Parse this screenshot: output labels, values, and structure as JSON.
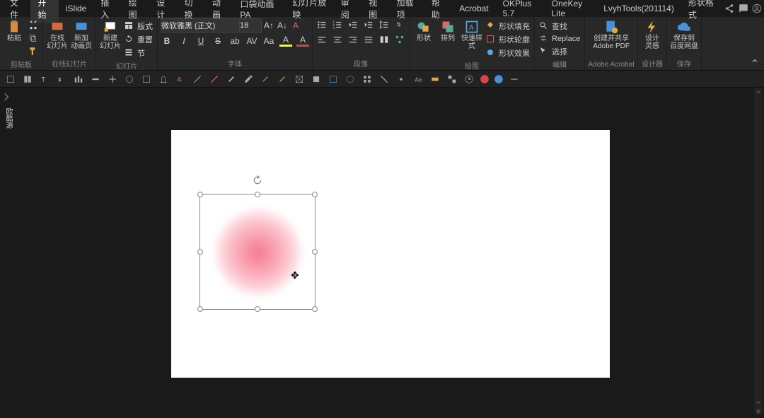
{
  "tabs": [
    "文件",
    "开始",
    "iSlide",
    "插入",
    "绘图",
    "设计",
    "切换",
    "动画",
    "口袋动画 PA",
    "幻灯片放映",
    "审阅",
    "视图",
    "加载项",
    "帮助",
    "Acrobat",
    "OKPlus 5.7",
    "OneKey Lite",
    "LvyhTools(201114)",
    "形状格式"
  ],
  "activeTab": 1,
  "ribbon": {
    "clipboard": {
      "paste": "粘贴",
      "label": "剪贴板"
    },
    "online": {
      "btn1": "在线\n幻灯片",
      "btn2": "新加\n动画页",
      "label": "在线幻灯片"
    },
    "slides": {
      "btn": "新建\n幻灯片",
      "opt1": "版式",
      "opt2": "重置",
      "opt3": "节",
      "label": "幻灯片"
    },
    "font": {
      "name": "微软雅黑 (正文)",
      "size": "18",
      "label": "字体"
    },
    "para": {
      "label": "段落"
    },
    "draw": {
      "b1": "形状",
      "b2": "排列",
      "b3": "快速样式",
      "o1": "形状填充",
      "o2": "形状轮廓",
      "o3": "形状效果",
      "label": "绘图"
    },
    "edit": {
      "o1": "查找",
      "o2": "Replace",
      "o3": "选择",
      "label": "编辑"
    },
    "acrobat": {
      "btn": "创建并共享\nAdobe PDF",
      "label": "Adobe Acrobat"
    },
    "designer": {
      "btn": "设计\n灵感",
      "label": "设计器"
    },
    "save": {
      "btn": "保存到\n百度网盘",
      "label": "保存"
    }
  },
  "sideLabel": "欧酷源"
}
